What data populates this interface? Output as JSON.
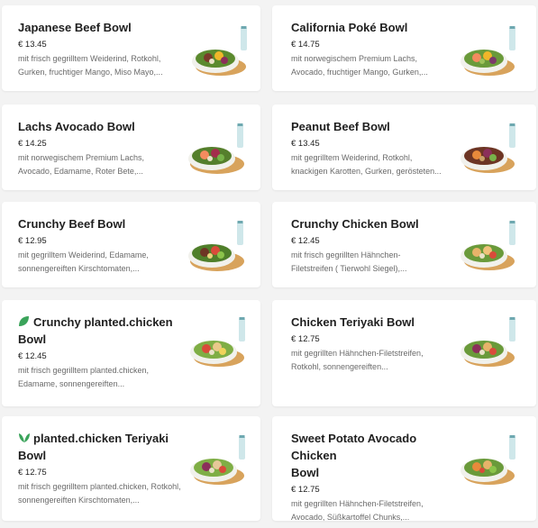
{
  "menu": {
    "items": [
      {
        "name": "Japanese Beef Bowl",
        "price": "€ 13.45",
        "desc1": "mit frisch gegrilltem Weiderind, Rotkohl,",
        "desc2": "Gurken, fruchtiger Mango, Miso Mayo,..."
      },
      {
        "name": "California Poké Bowl",
        "price": "€ 14.75",
        "desc1": "mit norwegischem Premium Lachs,",
        "desc2": "Avocado, fruchtiger Mango, Gurken,..."
      },
      {
        "name": "Lachs Avocado Bowl",
        "price": "€ 14.25",
        "desc1": "mit norwegischem Premium Lachs,",
        "desc2": "Avocado, Edamame, Roter Bete,..."
      },
      {
        "name": "Peanut Beef Bowl",
        "price": "€ 13.45",
        "desc1": "mit gegrilltem Weiderind, Rotkohl,",
        "desc2": "knackigen Karotten, Gurken, gerösteten..."
      },
      {
        "name": "Crunchy Beef Bowl",
        "price": "€ 12.95",
        "desc1": "mit gegrilltem Weiderind, Edamame,",
        "desc2": "sonnengereiften Kirschtomaten,..."
      },
      {
        "name": "Crunchy Chicken Bowl",
        "price": "€ 12.45",
        "desc1": "mit frisch gegrillten Hähnchen-",
        "desc2": "Filetstreifen ( Tierwohl Siegel),..."
      },
      {
        "name_line1": "Crunchy planted.chicken",
        "name_line2": "Bowl",
        "price": "€ 12.45",
        "desc1": "mit frisch gegrilltem planted.chicken,",
        "desc2": "Edamame, sonnengereiften..."
      },
      {
        "name": "Chicken Teriyaki Bowl",
        "price": "€ 12.75",
        "desc1": "mit gegrillten Hähnchen-Filetstreifen,",
        "desc2": "Rotkohl, sonnengereiften..."
      },
      {
        "name_line1": "planted.chicken Teriyaki",
        "name_line2": "Bowl",
        "price": "€ 12.75",
        "desc1": "mit frisch gegrilltem planted.chicken, Rotkohl,",
        "desc2": "sonnengereiften Kirschtomaten,..."
      },
      {
        "name_line1": "Sweet Potato Avocado Chicken",
        "name_line2": "Bowl",
        "price": "€ 12.75",
        "desc1": "mit gegrillten Hähnchen-Filetstreifen,",
        "desc2": "Avocado, Süßkartoffel Chunks,..."
      }
    ]
  },
  "colors": {
    "leaf_icon": "#3aa35a",
    "background": "#f3f3f3",
    "card": "#ffffff"
  }
}
